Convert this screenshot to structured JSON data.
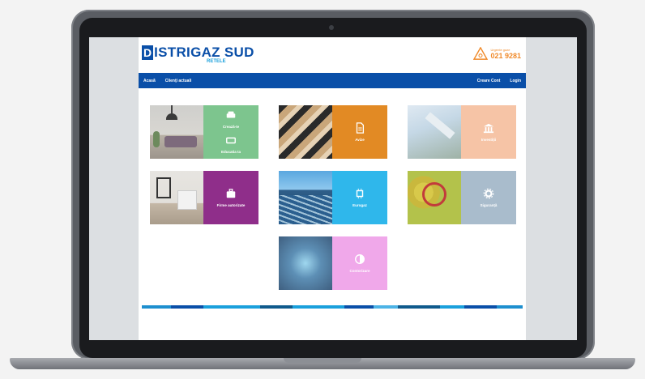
{
  "brand": {
    "mark": "D",
    "name": "ISTRIGAZ SUD",
    "subtitle": "RETELE"
  },
  "contact": {
    "label": "Urgente gaze",
    "number": "021 9281"
  },
  "nav": {
    "left": [
      "Acasă",
      "Clienţi actuali"
    ],
    "right": [
      "Creare Cont",
      "Login"
    ]
  },
  "tiles": [
    {
      "labels": [
        "Crează-te",
        "Educatia ta"
      ],
      "color": "#7dc58e"
    },
    {
      "labels": [
        "Avize"
      ],
      "color": "#e28a24"
    },
    {
      "labels": [
        "Investiții"
      ],
      "color": "#f6c4a6"
    },
    {
      "labels": [
        "Firme autorizate"
      ],
      "color": "#8f2e8a"
    },
    {
      "labels": [
        "Eurogaz"
      ],
      "color": "#2fb7eb"
    },
    {
      "labels": [
        "Siguranță"
      ],
      "color": "#a9bccc"
    },
    {
      "labels": [
        "Contorizare"
      ],
      "color": "#f0a8ea"
    }
  ],
  "colors": {
    "brand_blue": "#0a4fa8",
    "accent_orange": "#f08a2a"
  }
}
